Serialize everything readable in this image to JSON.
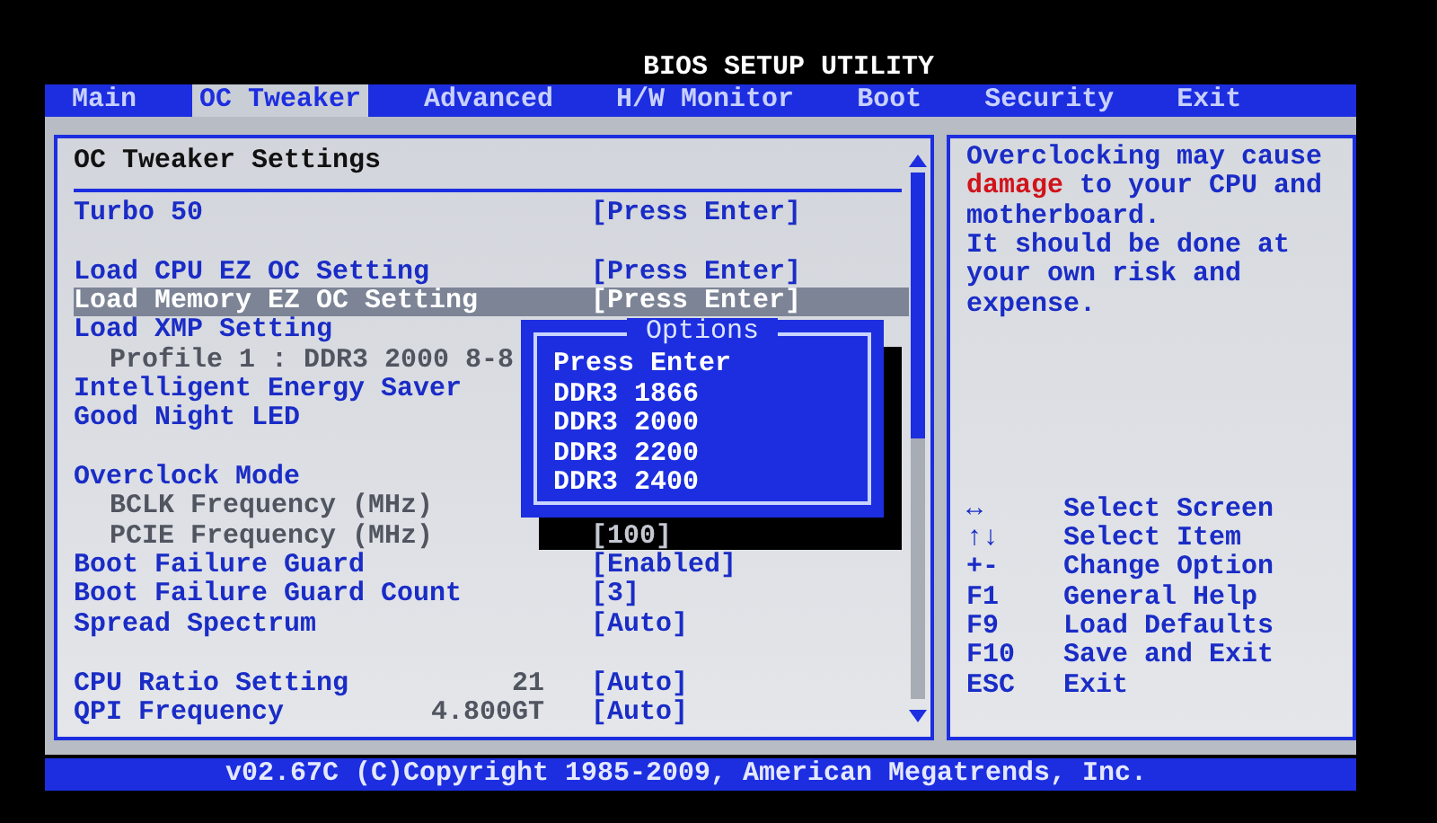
{
  "window": {
    "title": "BIOS SETUP UTILITY"
  },
  "tabs": [
    {
      "label": "Main",
      "selected": false
    },
    {
      "label": "OC Tweaker",
      "selected": true
    },
    {
      "label": "Advanced",
      "selected": false
    },
    {
      "label": "H/W Monitor",
      "selected": false
    },
    {
      "label": "Boot",
      "selected": false
    },
    {
      "label": "Security",
      "selected": false
    },
    {
      "label": "Exit",
      "selected": false
    }
  ],
  "settings": {
    "heading": "OC Tweaker Settings",
    "groups": [
      {
        "rows": [
          {
            "kind": "item",
            "label": "Turbo 50",
            "value": "[Press Enter]",
            "selected": false
          }
        ]
      },
      {
        "rows": [
          {
            "kind": "item",
            "label": "Load CPU EZ OC Setting",
            "value": "[Press Enter]",
            "selected": false
          },
          {
            "kind": "item",
            "label": "Load Memory EZ OC Setting",
            "value": "[Press Enter]",
            "selected": true
          },
          {
            "kind": "item",
            "label": "Load XMP Setting",
            "selected": false
          },
          {
            "kind": "sub",
            "label": "Profile 1 : DDR3 2000 8-8",
            "selected": false
          },
          {
            "kind": "item",
            "label": "Intelligent Energy Saver",
            "selected": false
          },
          {
            "kind": "item",
            "label": "Good Night LED",
            "selected": false
          }
        ]
      },
      {
        "rows": [
          {
            "kind": "item",
            "label": "Overclock Mode",
            "selected": false
          },
          {
            "kind": "sub",
            "label": "BCLK Frequency (MHz)",
            "selected": false
          },
          {
            "kind": "sub",
            "label": "PCIE Frequency (MHz)",
            "value": "[100]",
            "selected": false
          },
          {
            "kind": "item",
            "label": "Boot Failure Guard",
            "value": "[Enabled]",
            "selected": false
          },
          {
            "kind": "item",
            "label": "Boot Failure Guard Count",
            "value": "[3]",
            "selected": false
          },
          {
            "kind": "item",
            "label": "Spread Spectrum",
            "value": "[Auto]",
            "selected": false
          }
        ]
      },
      {
        "rows": [
          {
            "kind": "item",
            "label": "CPU Ratio Setting",
            "reading": "21",
            "value": "[Auto]",
            "selected": false
          },
          {
            "kind": "item",
            "label": "QPI Frequency",
            "reading": "4.800GT",
            "value": "[Auto]",
            "selected": false
          }
        ]
      }
    ]
  },
  "options_popup": {
    "title": "Options",
    "items": [
      "Press Enter",
      "DDR3 1866",
      "DDR3 2000",
      "DDR3 2200",
      "DDR3 2400"
    ]
  },
  "help": {
    "paragraphs": [
      [
        {
          "text": "Overclocking may cause ",
          "warning": false
        },
        {
          "text": "damage",
          "warning": true
        },
        {
          "text": " to your CPU and motherboard.",
          "warning": false
        }
      ],
      [
        {
          "text": "It should be done at your own risk and expense.",
          "warning": false
        }
      ]
    ],
    "keys": [
      {
        "key": "↔",
        "action": "Select Screen"
      },
      {
        "key": "↑↓",
        "action": "Select Item"
      },
      {
        "key": "+-",
        "action": "Change Option"
      },
      {
        "key": "F1",
        "action": "General Help"
      },
      {
        "key": "F9",
        "action": "Load Defaults"
      },
      {
        "key": "F10",
        "action": "Save and Exit"
      },
      {
        "key": "ESC",
        "action": "Exit"
      }
    ]
  },
  "footer": "v02.67C (C)Copyright 1985-2009, American Megatrends, Inc."
}
